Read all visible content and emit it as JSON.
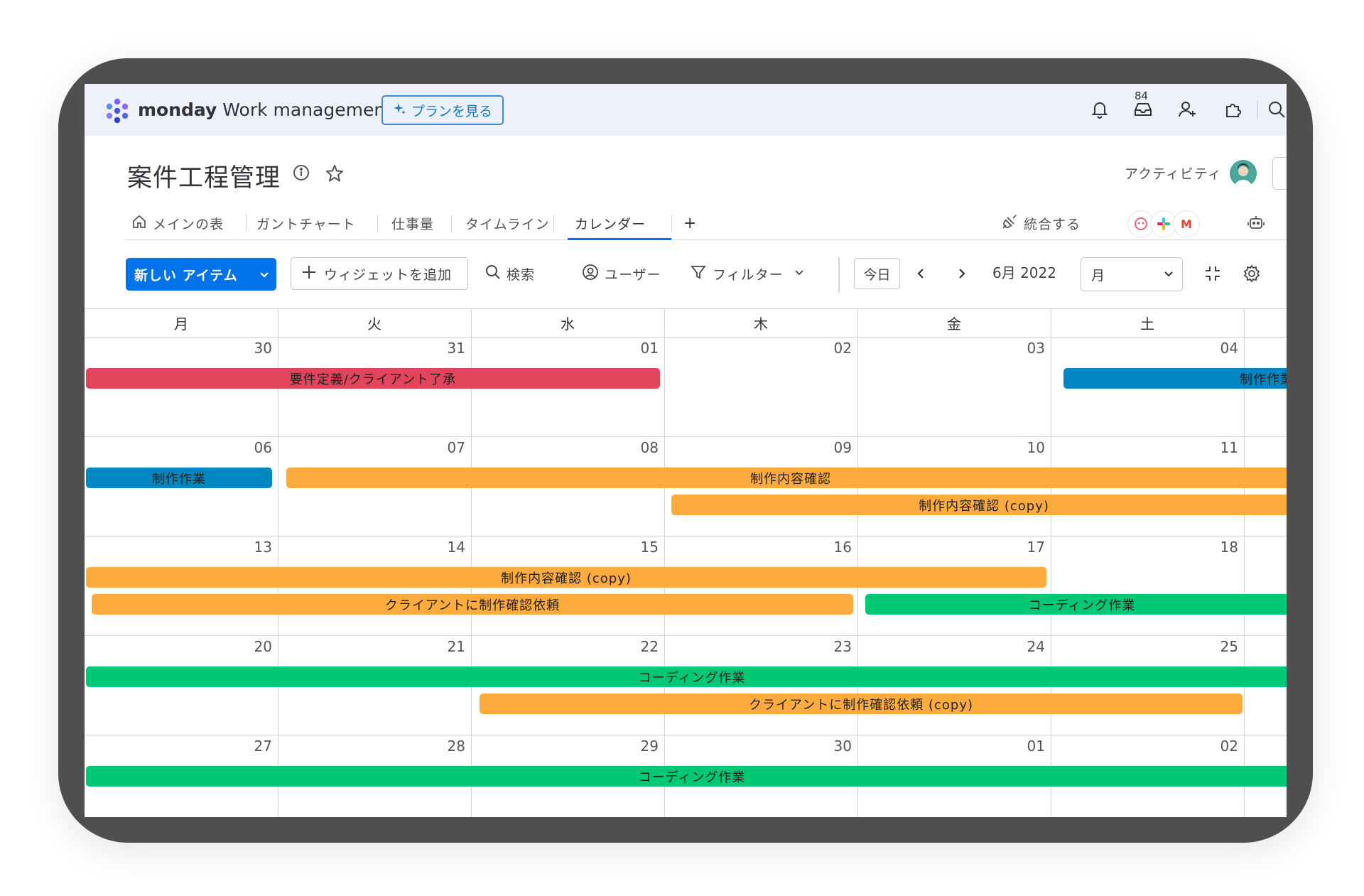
{
  "app": {
    "brand_bold": "monday",
    "brand_light": " Work management",
    "plan_button": "プランを見る",
    "inbox_count": "84"
  },
  "board": {
    "title": "案件工程管理",
    "activity_label": "アクティビティ"
  },
  "tabs": [
    {
      "label": "メインの表"
    },
    {
      "label": "ガントチャート"
    },
    {
      "label": "仕事量"
    },
    {
      "label": "タイムライン"
    },
    {
      "label": "カレンダー",
      "active": true
    },
    {
      "label": "+"
    }
  ],
  "integrate_label": "統合する",
  "integration_letters": [
    "M"
  ],
  "toolbar": {
    "new_item": "新しい アイテム",
    "add_widget": "ウィジェットを追加",
    "search": "検索",
    "user": "ユーザー",
    "filter": "フィルター",
    "today": "今日",
    "month_label": "6月 2022",
    "view_mode": "月"
  },
  "calendar": {
    "weekdays": [
      "月",
      "火",
      "水",
      "木",
      "金",
      "土"
    ],
    "weeks": [
      [
        "30",
        "31",
        "01",
        "02",
        "03",
        "04"
      ],
      [
        "06",
        "07",
        "08",
        "09",
        "10",
        "11"
      ],
      [
        "13",
        "14",
        "15",
        "16",
        "17",
        "18"
      ],
      [
        "20",
        "21",
        "22",
        "23",
        "24",
        "25"
      ],
      [
        "27",
        "28",
        "29",
        "30",
        "01",
        "02"
      ]
    ],
    "events": [
      {
        "label": "要件定義/クライアント了承",
        "color": "#e2445c"
      },
      {
        "label": "制作作業",
        "color": "#0086c0"
      },
      {
        "label": "制作作業",
        "color": "#0086c0"
      },
      {
        "label": "制作内容確認",
        "color": "#fdab3d"
      },
      {
        "label": "制作内容確認 (copy)",
        "color": "#fdab3d"
      },
      {
        "label": "制作内容確認 (copy)",
        "color": "#fdab3d"
      },
      {
        "label": "クライアントに制作確認依頼",
        "color": "#fdab3d"
      },
      {
        "label": "コーディング作業",
        "color": "#00c875"
      },
      {
        "label": "コーディング作業",
        "color": "#00c875"
      },
      {
        "label": "クライアントに制作確認依頼 (copy)",
        "color": "#fdab3d"
      },
      {
        "label": "コーディング作業",
        "color": "#00c875"
      }
    ]
  }
}
